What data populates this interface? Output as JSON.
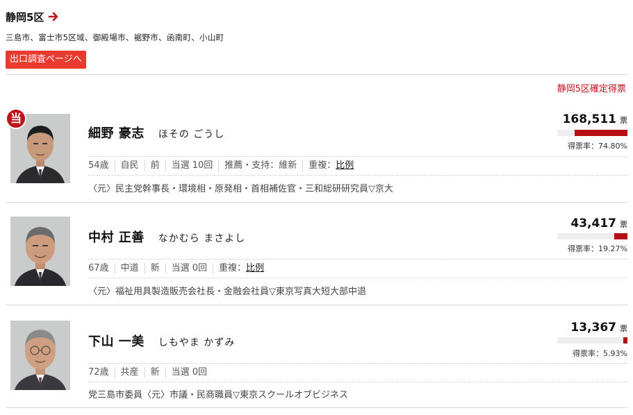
{
  "district": {
    "title": "静岡5区",
    "municipalities": "三島市、富士市5区域、御殿場市、裾野市、函南町、小山町",
    "exit_poll_button": "出口調査ページへ",
    "confirmed_label": "静岡5区確定得票"
  },
  "colors": {
    "accent_red": "#c0141b",
    "button_red": "#e83a2f",
    "bar_fill": "#b50f14"
  },
  "candidates": [
    {
      "elected_badge": "当",
      "name": "細野 豪志",
      "kana": "ほその ごうし",
      "age": "54歳",
      "party": "自民",
      "status": "前",
      "wins": "当選 10回",
      "support": "推薦・支持：維新",
      "dual_prefix": "重複：",
      "dual_link": "比例",
      "career": "〈元〉民主党幹事長・環境相・原発相・首相補佐官・三和総研研究員▽京大",
      "votes": "168,511",
      "vote_unit": "票",
      "rate_text": "得票率：74.80%",
      "rate_value": 74.8
    },
    {
      "name": "中村 正善",
      "kana": "なかむら まさよし",
      "age": "67歳",
      "party": "中道",
      "status": "新",
      "wins": "当選 0回",
      "dual_prefix": "重複：",
      "dual_link": "比例",
      "career": "〈元〉福祉用具製造販売会社長・金融会社員▽東京写真大短大部中退",
      "votes": "43,417",
      "vote_unit": "票",
      "rate_text": "得票率：19.27%",
      "rate_value": 19.27
    },
    {
      "name": "下山 一美",
      "kana": "しもやま かずみ",
      "age": "72歳",
      "party": "共産",
      "status": "新",
      "wins": "当選 0回",
      "career": "党三島市委員〈元〉市議・民商職員▽東京スクールオブビジネス",
      "votes": "13,367",
      "vote_unit": "票",
      "rate_text": "得票率：5.93%",
      "rate_value": 5.93
    }
  ]
}
